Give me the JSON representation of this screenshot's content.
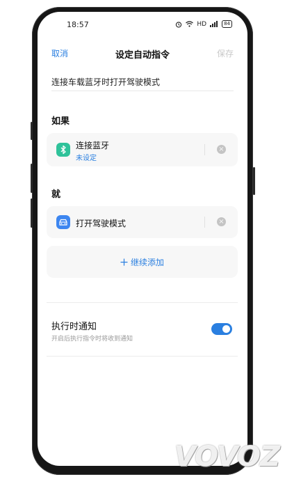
{
  "status_bar": {
    "time": "18:57",
    "alarm_icon": "alarm-icon",
    "wifi_icon": "wifi-icon",
    "network": "HD",
    "signal": "5G",
    "battery": "84"
  },
  "nav": {
    "cancel_label": "取消",
    "title": "设定自动指令",
    "save_label": "保存"
  },
  "command_name": "连接车载蓝牙时打开驾驶模式",
  "if_section": {
    "label": "如果",
    "condition": {
      "icon": "bluetooth-icon",
      "icon_color": "#2fc29a",
      "title": "连接蓝牙",
      "subtitle": "未设定"
    }
  },
  "then_section": {
    "label": "就",
    "action": {
      "icon": "car-icon",
      "icon_color": "#3d86f0",
      "title": "打开驾驶模式"
    },
    "add_label": "继续添加"
  },
  "notify": {
    "title": "执行时通知",
    "subtitle": "开启后执行指令时将收到通知",
    "enabled": true
  },
  "colors": {
    "accent": "#2a7fe0",
    "card_bg": "#f7f7f7"
  },
  "watermark": "VOVOZ"
}
